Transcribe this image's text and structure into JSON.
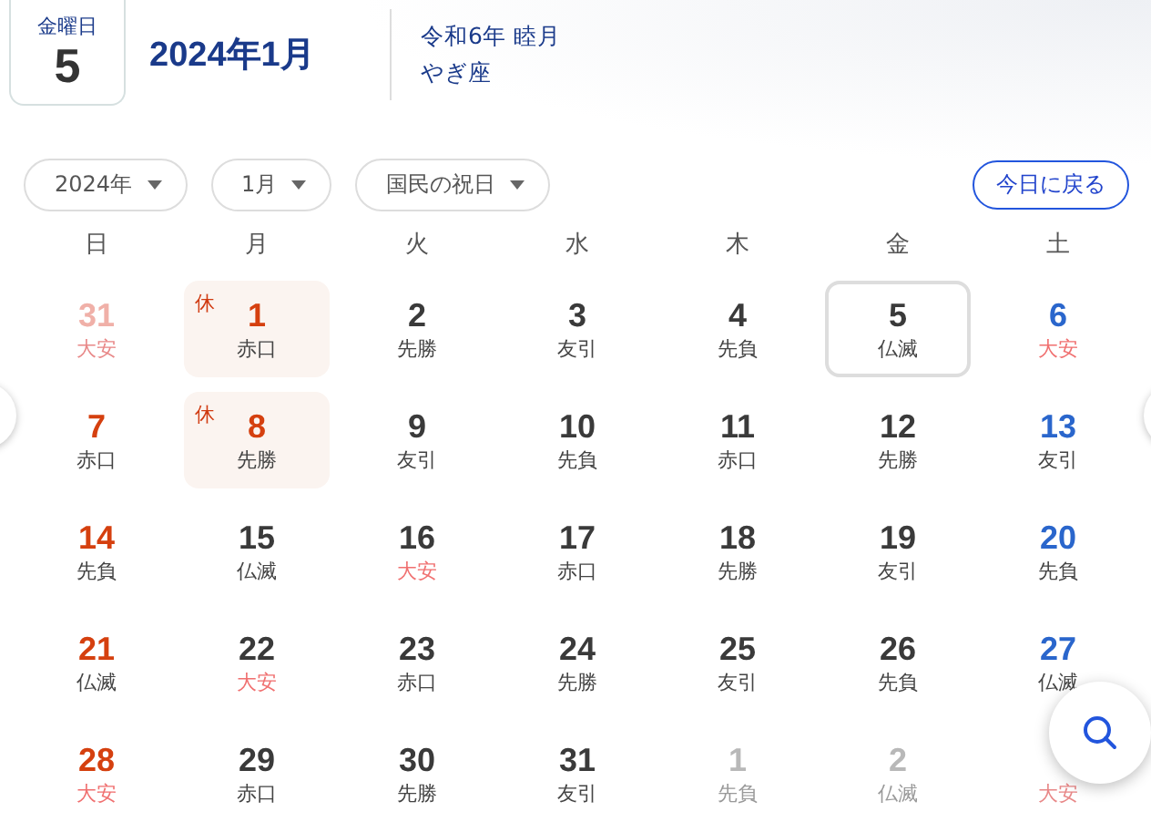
{
  "header": {
    "weekday": "金曜日",
    "day": "5",
    "title": "2024年1月",
    "era": "令和6年 睦月",
    "zodiac": "やぎ座"
  },
  "filters": [
    {
      "label": "2024年"
    },
    {
      "label": "1月"
    },
    {
      "label": "国民の祝日"
    }
  ],
  "today_button": "今日に戻る",
  "weekdays": [
    "日",
    "月",
    "火",
    "水",
    "木",
    "金",
    "土"
  ],
  "days": [
    {
      "date": "31",
      "rokuyo": "大安",
      "outside": true,
      "holiday": false,
      "selected": false,
      "lucky": true
    },
    {
      "date": "1",
      "rokuyo": "赤口",
      "outside": false,
      "holiday": true,
      "badge": "休",
      "selected": false,
      "lucky": false
    },
    {
      "date": "2",
      "rokuyo": "先勝",
      "outside": false,
      "holiday": false,
      "selected": false,
      "lucky": false
    },
    {
      "date": "3",
      "rokuyo": "友引",
      "outside": false,
      "holiday": false,
      "selected": false,
      "lucky": false
    },
    {
      "date": "4",
      "rokuyo": "先負",
      "outside": false,
      "holiday": false,
      "selected": false,
      "lucky": false
    },
    {
      "date": "5",
      "rokuyo": "仏滅",
      "outside": false,
      "holiday": false,
      "selected": true,
      "lucky": false
    },
    {
      "date": "6",
      "rokuyo": "大安",
      "outside": false,
      "holiday": false,
      "selected": false,
      "lucky": true
    },
    {
      "date": "7",
      "rokuyo": "赤口",
      "outside": false,
      "holiday": false,
      "selected": false,
      "lucky": false
    },
    {
      "date": "8",
      "rokuyo": "先勝",
      "outside": false,
      "holiday": true,
      "badge": "休",
      "selected": false,
      "lucky": false
    },
    {
      "date": "9",
      "rokuyo": "友引",
      "outside": false,
      "holiday": false,
      "selected": false,
      "lucky": false
    },
    {
      "date": "10",
      "rokuyo": "先負",
      "outside": false,
      "holiday": false,
      "selected": false,
      "lucky": false
    },
    {
      "date": "11",
      "rokuyo": "赤口",
      "outside": false,
      "holiday": false,
      "selected": false,
      "lucky": false
    },
    {
      "date": "12",
      "rokuyo": "先勝",
      "outside": false,
      "holiday": false,
      "selected": false,
      "lucky": false
    },
    {
      "date": "13",
      "rokuyo": "友引",
      "outside": false,
      "holiday": false,
      "selected": false,
      "lucky": false
    },
    {
      "date": "14",
      "rokuyo": "先負",
      "outside": false,
      "holiday": false,
      "selected": false,
      "lucky": false
    },
    {
      "date": "15",
      "rokuyo": "仏滅",
      "outside": false,
      "holiday": false,
      "selected": false,
      "lucky": false
    },
    {
      "date": "16",
      "rokuyo": "大安",
      "outside": false,
      "holiday": false,
      "selected": false,
      "lucky": true
    },
    {
      "date": "17",
      "rokuyo": "赤口",
      "outside": false,
      "holiday": false,
      "selected": false,
      "lucky": false
    },
    {
      "date": "18",
      "rokuyo": "先勝",
      "outside": false,
      "holiday": false,
      "selected": false,
      "lucky": false
    },
    {
      "date": "19",
      "rokuyo": "友引",
      "outside": false,
      "holiday": false,
      "selected": false,
      "lucky": false
    },
    {
      "date": "20",
      "rokuyo": "先負",
      "outside": false,
      "holiday": false,
      "selected": false,
      "lucky": false
    },
    {
      "date": "21",
      "rokuyo": "仏滅",
      "outside": false,
      "holiday": false,
      "selected": false,
      "lucky": false
    },
    {
      "date": "22",
      "rokuyo": "大安",
      "outside": false,
      "holiday": false,
      "selected": false,
      "lucky": true
    },
    {
      "date": "23",
      "rokuyo": "赤口",
      "outside": false,
      "holiday": false,
      "selected": false,
      "lucky": false
    },
    {
      "date": "24",
      "rokuyo": "先勝",
      "outside": false,
      "holiday": false,
      "selected": false,
      "lucky": false
    },
    {
      "date": "25",
      "rokuyo": "友引",
      "outside": false,
      "holiday": false,
      "selected": false,
      "lucky": false
    },
    {
      "date": "26",
      "rokuyo": "先負",
      "outside": false,
      "holiday": false,
      "selected": false,
      "lucky": false
    },
    {
      "date": "27",
      "rokuyo": "仏滅",
      "outside": false,
      "holiday": false,
      "selected": false,
      "lucky": false
    },
    {
      "date": "28",
      "rokuyo": "大安",
      "outside": false,
      "holiday": false,
      "selected": false,
      "lucky": true
    },
    {
      "date": "29",
      "rokuyo": "赤口",
      "outside": false,
      "holiday": false,
      "selected": false,
      "lucky": false
    },
    {
      "date": "30",
      "rokuyo": "先勝",
      "outside": false,
      "holiday": false,
      "selected": false,
      "lucky": false
    },
    {
      "date": "31",
      "rokuyo": "友引",
      "outside": false,
      "holiday": false,
      "selected": false,
      "lucky": false
    },
    {
      "date": "1",
      "rokuyo": "先負",
      "outside": true,
      "holiday": false,
      "selected": false,
      "lucky": false
    },
    {
      "date": "2",
      "rokuyo": "仏滅",
      "outside": true,
      "holiday": false,
      "selected": false,
      "lucky": false
    },
    {
      "rokuyo": "大安",
      "outside": true,
      "holiday": false,
      "selected": false,
      "lucky": true
    }
  ]
}
